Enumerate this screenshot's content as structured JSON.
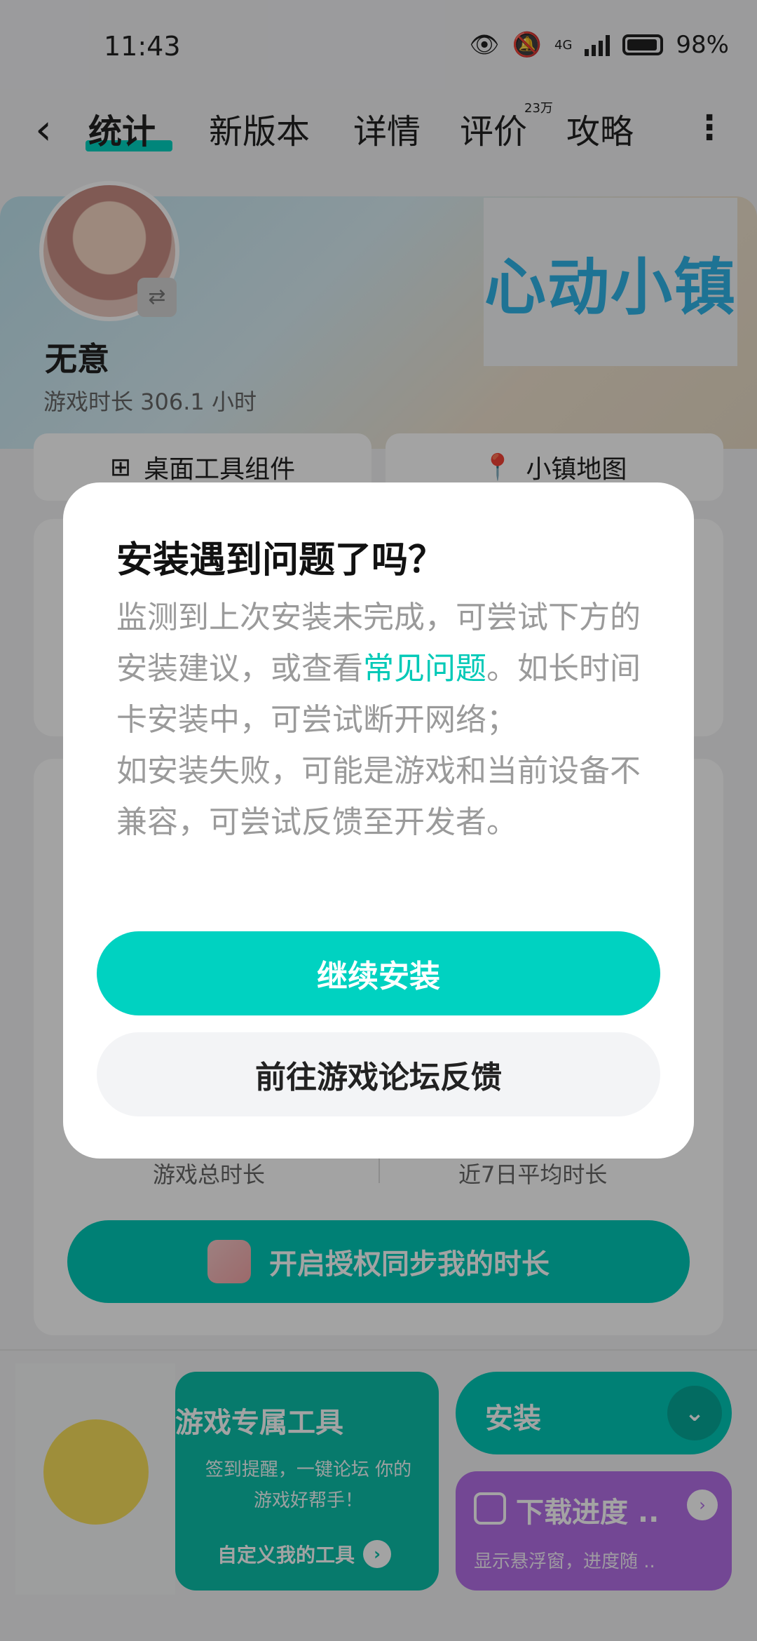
{
  "status_bar": {
    "time": "11:43",
    "network": "4G",
    "battery": "98%"
  },
  "header": {
    "tabs": [
      {
        "label": "统计"
      },
      {
        "label": "新版本"
      },
      {
        "label": "详情"
      },
      {
        "label": "评价"
      },
      {
        "label": "攻略"
      }
    ],
    "review_badge": "23万"
  },
  "profile": {
    "username": "无意",
    "playtime": "游戏时长 306.1 小时",
    "game_logo": "心动小镇"
  },
  "quick_cards": {
    "widget": "桌面工具组件",
    "map": "小镇地图"
  },
  "stats": {
    "total_label": "游戏总时长",
    "avg_label": "近7日平均时长",
    "sync_button": "开启授权同步我的时长"
  },
  "bottom": {
    "tool_title": "游戏专属工具",
    "tool_desc": "签到提醒，一键论坛 你的游戏好帮手！",
    "tool_link": "自定义我的工具",
    "install_label": "安装",
    "progress_title": "下载进度 ..",
    "progress_sub": "显示悬浮窗，进度随 .."
  },
  "dialog": {
    "title": "安装遇到问题了吗？",
    "body_part1": "监测到上次安装未完成，可尝试下方的安装建议，或查看",
    "body_link": "常见问题",
    "body_part2": "。如长时间卡安装中，可尝试断开网络；",
    "body_part3": "如安装失败，可能是游戏和当前设备不兼容，可尝试反馈至开发者。",
    "primary_button": "继续安装",
    "secondary_button": "前往游戏论坛反馈"
  },
  "colors": {
    "accent": "#00d2c1",
    "progress_card": "#b570e8"
  }
}
